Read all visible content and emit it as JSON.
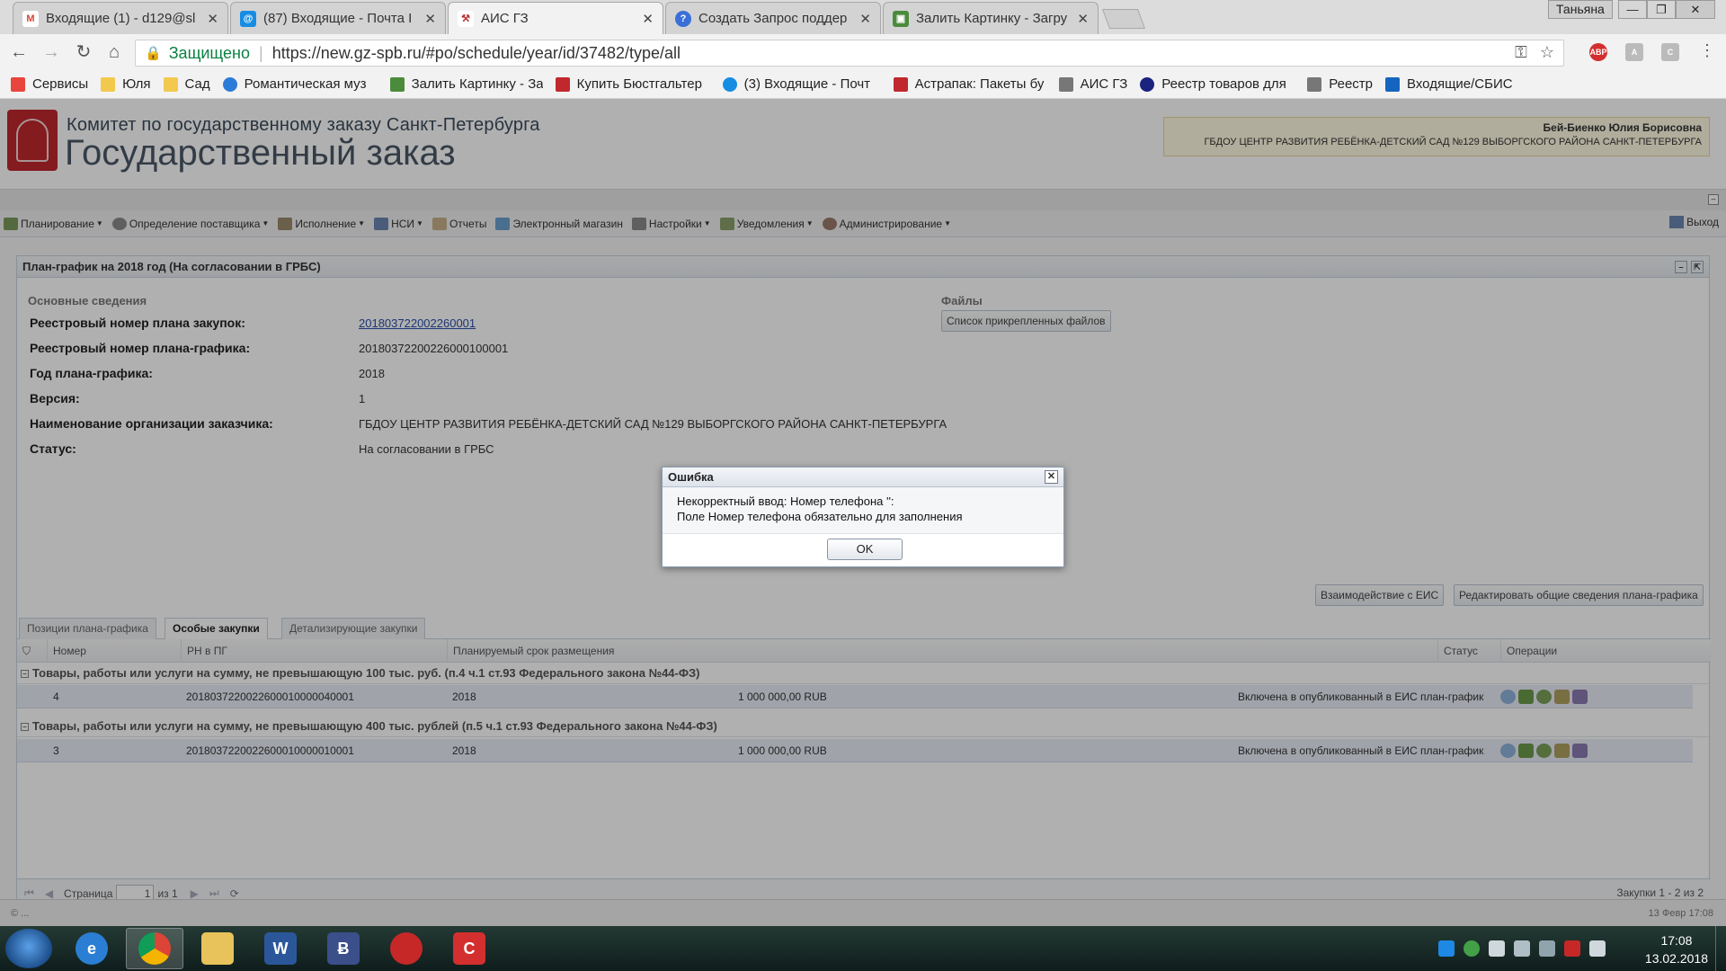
{
  "browser": {
    "tabs": [
      {
        "label": "Входящие (1) - d129@sl",
        "icon": "gmail-icon",
        "color": "#d44638",
        "glyph": "M"
      },
      {
        "label": "(87) Входящие - Почта I",
        "icon": "mailru-icon",
        "color": "#168de2",
        "glyph": "@"
      },
      {
        "label": "АИС ГЗ",
        "icon": "tools-icon",
        "color": "#b33",
        "glyph": "⚒"
      },
      {
        "label": "Создать Запрос поддер",
        "icon": "help-icon",
        "color": "#3a6fd8",
        "glyph": "?"
      },
      {
        "label": "Залить Картинку - Загру",
        "icon": "image-host-icon",
        "color": "#4b8b3b",
        "glyph": "▣"
      }
    ],
    "profile": "Таньяна",
    "secure_label": "Защищено",
    "url": "https://new.gz-spb.ru/#po/schedule/year/id/37482/type/all",
    "bookmarks": [
      {
        "label": "Сервисы",
        "color": "#e8453c"
      },
      {
        "label": "Юля",
        "color": "#f2c94c"
      },
      {
        "label": "Сад",
        "color": "#f2c94c"
      },
      {
        "label": "Романтическая муз",
        "color": "#2d7bd8"
      },
      {
        "label": "Залить Картинку - За",
        "color": "#4b8b3b"
      },
      {
        "label": "Купить Бюстгальтер",
        "color": "#c0282d"
      },
      {
        "label": "(3) Входящие - Почт",
        "color": "#168de2"
      },
      {
        "label": "Астрапак: Пакеты бу",
        "color": "#c0282d"
      },
      {
        "label": "АИС ГЗ",
        "color": "#777"
      },
      {
        "label": "Реестр товаров для",
        "color": "#1a237e"
      },
      {
        "label": "Реестр",
        "color": "#777"
      },
      {
        "label": "Входящие/СБИС",
        "color": "#1565c0"
      }
    ]
  },
  "header": {
    "line1": "Комитет по государственному заказу Санкт-Петербурга",
    "line2": "Государственный заказ",
    "user_name": "Бей-Биенко Юлия Борисовна",
    "user_org": "ГБДОУ ЦЕНТР РАЗВИТИЯ РЕБЁНКА-ДЕТСКИЙ САД №129 ВЫБОРГСКОГО РАЙОНА САНКТ-ПЕТЕРБУРГА"
  },
  "menu": {
    "items": [
      {
        "label": "Планирование",
        "caret": true
      },
      {
        "label": "Определение поставщика",
        "caret": true
      },
      {
        "label": "Исполнение",
        "caret": true
      },
      {
        "label": "НСИ",
        "caret": true
      },
      {
        "label": "Отчеты",
        "caret": false
      },
      {
        "label": "Электронный магазин",
        "caret": false
      },
      {
        "label": "Настройки",
        "caret": true
      },
      {
        "label": "Уведомления",
        "caret": true
      },
      {
        "label": "Администрирование",
        "caret": true
      }
    ],
    "exit": "Выход"
  },
  "panel": {
    "title": "План-график на 2018 год (На согласовании в ГРБС)",
    "section_main": "Основные сведения",
    "section_files": "Файлы",
    "files_button": "Список прикрепленных файлов",
    "fields": [
      {
        "label": "Реестровый номер плана закупок:",
        "value": "201803722002260001"
      },
      {
        "label": "Реестровый номер плана-графика:",
        "value": "20180372200226000100001"
      },
      {
        "label": "Год плана-графика:",
        "value": "2018"
      },
      {
        "label": "Версия:",
        "value": "1"
      },
      {
        "label": "Наименование организации заказчика:",
        "value": "ГБДОУ ЦЕНТР РАЗВИТИЯ РЕБЁНКА-ДЕТСКИЙ САД №129 ВЫБОРГСКОГО РАЙОНА САНКТ-ПЕТЕРБУРГА"
      },
      {
        "label": "Статус:",
        "value": "На согласовании в ГРБС"
      }
    ],
    "btn_eis": "Взаимодействие с ЕИС",
    "btn_edit": "Редактировать общие сведения плана-графика",
    "tabs": [
      "Позиции плана-графика",
      "Особые закупки",
      "Детализирующие закупки"
    ],
    "columns": {
      "number": "Номер",
      "rn": "РН в ПГ",
      "term": "Планируемый срок размещения",
      "status": "Статус",
      "ops": "Операции"
    },
    "groups": [
      {
        "title": "Товары, работы или услуги на сумму, не превышающую 100 тыс. руб. (п.4 ч.1 ст.93 Федерального закона №44-ФЗ)",
        "row": {
          "number": "4",
          "rn": "2018037220022600010000040001",
          "year": "2018",
          "sum": "1 000 000,00 RUB",
          "status": "Включена в опубликованный в ЕИС план-график"
        }
      },
      {
        "title": "Товары, работы или услуги на сумму, не превышающую 400 тыс. рублей (п.5 ч.1 ст.93 Федерального закона №44-ФЗ)",
        "row": {
          "number": "3",
          "rn": "2018037220022600010000010001",
          "year": "2018",
          "sum": "1 000 000,00 RUB",
          "status": "Включена в опубликованный в ЕИС план-график"
        }
      }
    ],
    "pager": {
      "page_label": "Страница",
      "page": "1",
      "of": "из 1",
      "summary": "Закупки 1 - 2 из 2"
    }
  },
  "footer": {
    "left": "© ...",
    "right": "13 Февр 17:08"
  },
  "dialog": {
    "title": "Ошибка",
    "line1": "Некорректный ввод: Номер телефона '':",
    "line2": "Поле Номер телефона обязательно для заполнения",
    "ok": "OK"
  },
  "taskbar": {
    "time": "17:08",
    "date": "13.02.2018",
    "apps": [
      "internet-explorer-icon",
      "chrome-icon",
      "explorer-folder-icon",
      "word-icon",
      "bank-client-icon",
      "game-icon",
      "c-app-icon"
    ]
  }
}
